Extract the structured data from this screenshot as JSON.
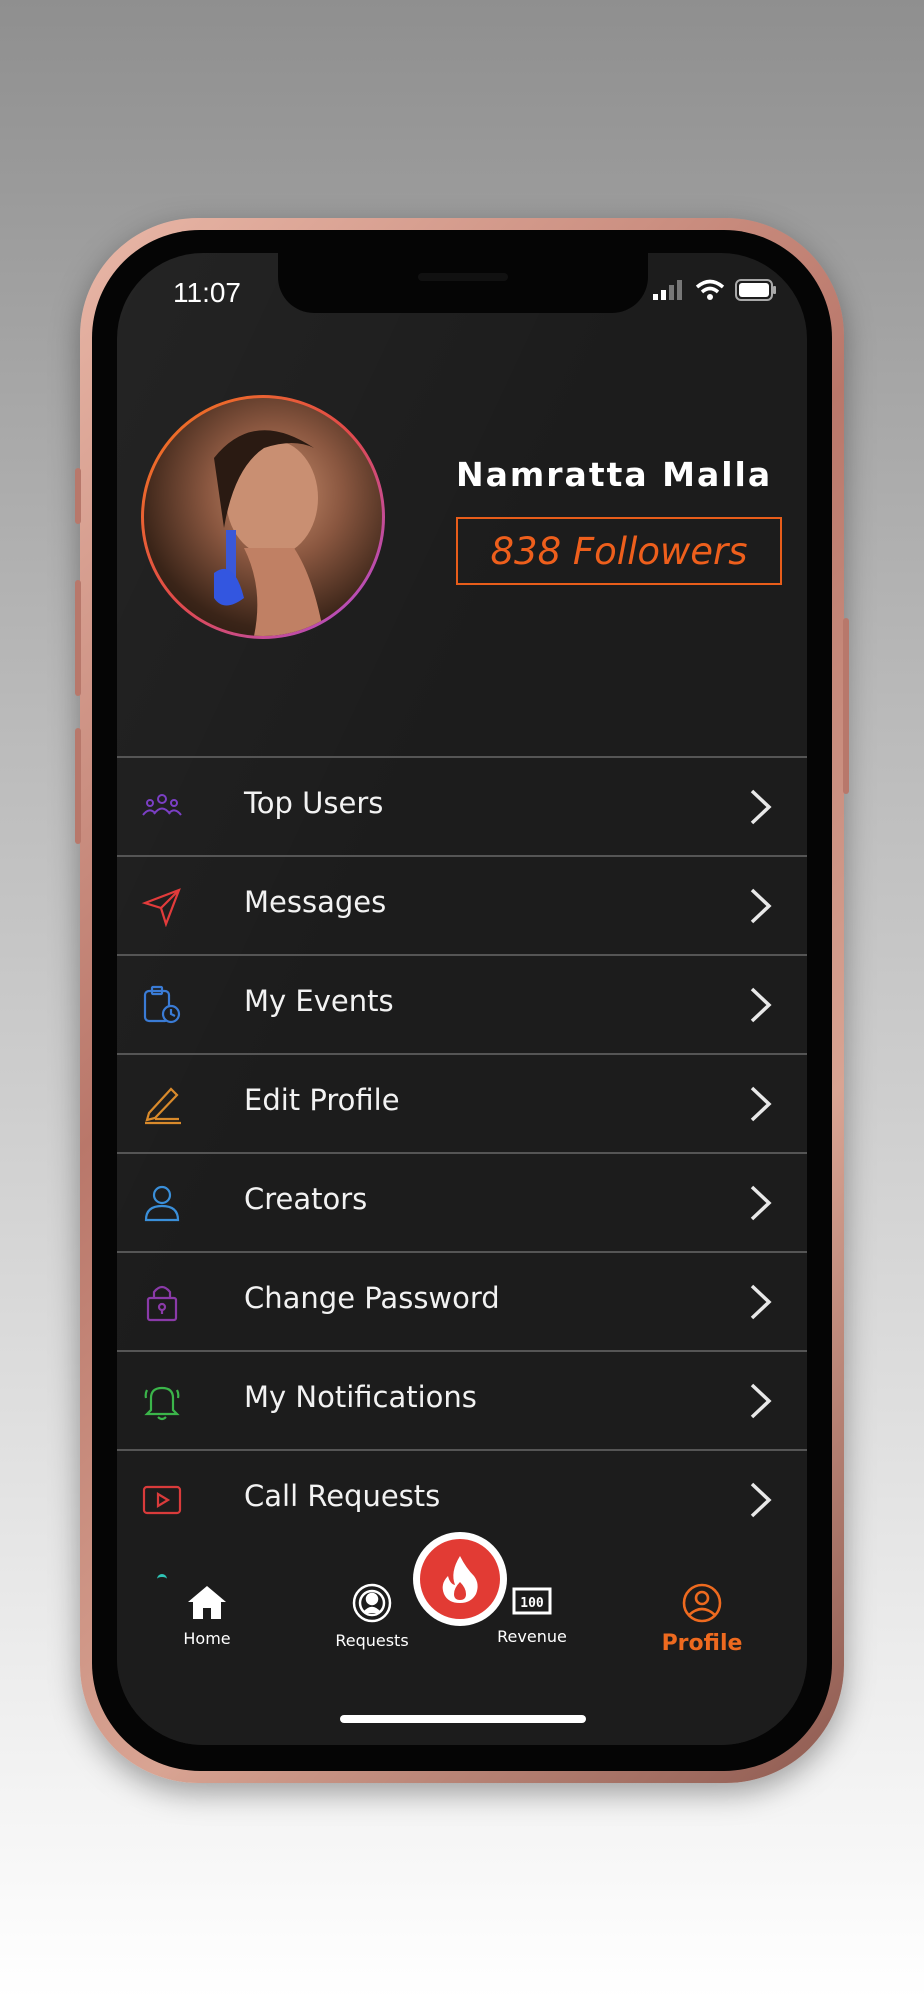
{
  "status_bar": {
    "time": "11:07"
  },
  "profile": {
    "name": "Namratta Malla",
    "followers": "838 Followers"
  },
  "menu": {
    "items": [
      {
        "label": "Top Users",
        "icon": "users-group-icon",
        "color": "#7b3fc4"
      },
      {
        "label": "Messages",
        "icon": "send-icon",
        "color": "#e23b3b"
      },
      {
        "label": "My Events",
        "icon": "calendar-clock-icon",
        "color": "#3a7bd5"
      },
      {
        "label": "Edit Profile",
        "icon": "pencil-icon",
        "color": "#d98a2b"
      },
      {
        "label": "Creators",
        "icon": "user-icon",
        "color": "#3a8fd9"
      },
      {
        "label": "Change Password",
        "icon": "lock-icon",
        "color": "#8a3aa8"
      },
      {
        "label": "My Notifications",
        "icon": "bell-icon",
        "color": "#3bb54a"
      },
      {
        "label": "Call Requests",
        "icon": "video-icon",
        "color": "#d93b3b"
      }
    ]
  },
  "tabbar": {
    "tabs": [
      {
        "label": "Home",
        "icon": "home-icon"
      },
      {
        "label": "Requests",
        "icon": "requests-icon"
      },
      {
        "label": "Revenue",
        "icon": "revenue-icon"
      },
      {
        "label": "Profile",
        "icon": "profile-icon",
        "active": true
      }
    ],
    "center_action": {
      "icon": "flame-icon"
    }
  },
  "colors": {
    "accent": "#ee5f1c",
    "background": "#1c1c1c",
    "divider": "#555555",
    "fab": "#e23b34"
  }
}
